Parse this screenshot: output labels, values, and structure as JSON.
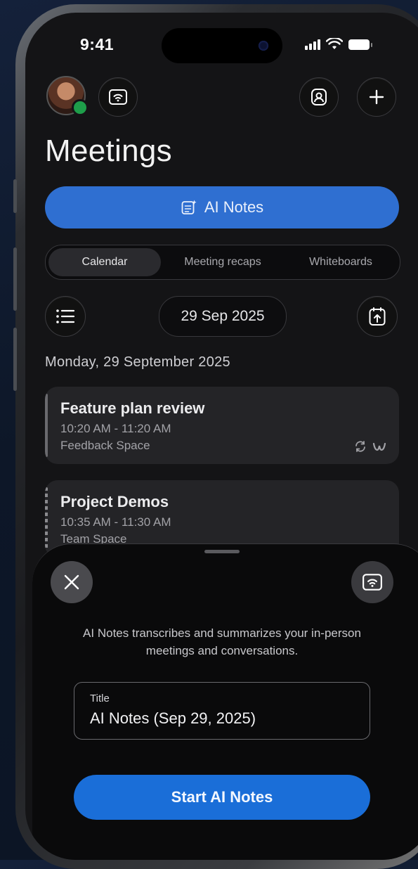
{
  "status_bar": {
    "time": "9:41"
  },
  "header": {
    "avatar_label": "User avatar",
    "title": "Meetings"
  },
  "ai_notes_button": {
    "label": "AI Notes"
  },
  "tabs": [
    {
      "label": "Calendar",
      "active": true
    },
    {
      "label": "Meeting recaps",
      "active": false
    },
    {
      "label": "Whiteboards",
      "active": false
    }
  ],
  "date_picker": {
    "value": "29 Sep 2025"
  },
  "day_heading": "Monday, 29 September 2025",
  "meetings": [
    {
      "title": "Feature plan review",
      "time": "10:20 AM - 11:20 AM",
      "location": "Feedback Space"
    },
    {
      "title": "Project Demos",
      "time": "10:35 AM - 11:30 AM",
      "location": "Team Space"
    }
  ],
  "sheet": {
    "description": "AI Notes transcribes and summarizes your in-person meetings and conversations.",
    "title_field_label": "Title",
    "title_field_value": "AI Notes (Sep 29, 2025)",
    "start_button": "Start AI Notes"
  },
  "colors": {
    "accent_blue": "#2f6fd1",
    "start_blue": "#1a6ed8",
    "presence_green": "#1e9e4a",
    "background": "#141416"
  },
  "icons": [
    "cast-icon",
    "contact-icon",
    "plus-icon",
    "list-icon",
    "calendar-export-icon",
    "close-icon",
    "recurring-icon",
    "webex-icon",
    "notes-sparkle-icon"
  ]
}
